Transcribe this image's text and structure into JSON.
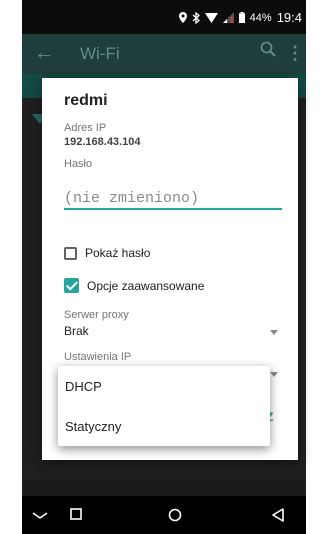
{
  "status_bar": {
    "battery": "44%",
    "time": "19:4"
  },
  "app_bar": {
    "title": "Wi-Fi"
  },
  "dialog": {
    "title": "redmi",
    "ip_label": "Adres IP",
    "ip_value": "192.168.43.104",
    "password_label": "Hasło",
    "password_placeholder": "(nie zmieniono)",
    "show_password_label": "Pokaż hasło",
    "advanced_options_label": "Opcje zaawansowane",
    "proxy_label": "Serwer proxy",
    "proxy_value": "Brak",
    "ip_settings_label": "Ustawienia IP",
    "button_partial": "Z"
  },
  "dropdown": {
    "options": [
      "DHCP",
      "Statyczny"
    ]
  },
  "colors": {
    "accent": "#26a69a",
    "app_bar": "#1f3d3a"
  }
}
